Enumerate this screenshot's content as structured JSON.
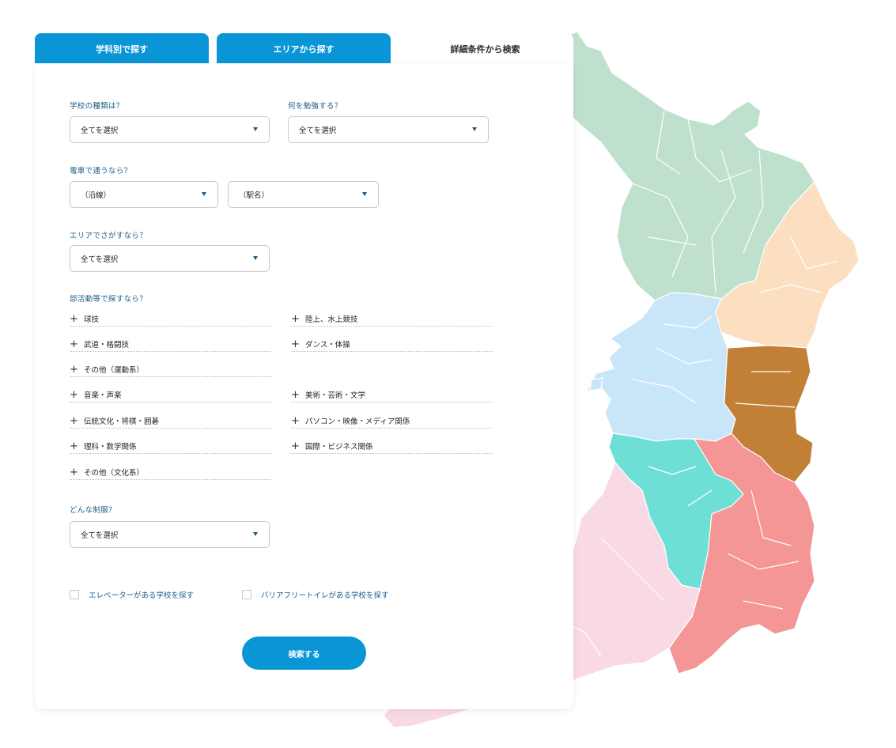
{
  "tabs": [
    {
      "label": "学科別で探す"
    },
    {
      "label": "エリアから探す"
    },
    {
      "label": "詳細条件から検索"
    }
  ],
  "school_type": {
    "label": "学校の種類は？",
    "value": "全てを選択"
  },
  "study": {
    "label": "何を勉強する？",
    "value": "全てを選択"
  },
  "train": {
    "label": "電車で通うなら？",
    "line_value": "（沿線）",
    "station_value": "（駅名）"
  },
  "area": {
    "label": "エリアでさがすなら？",
    "value": "全てを選択"
  },
  "clubs": {
    "label": "部活動等で探すなら？",
    "items": [
      "球技",
      "陸上、水上競技",
      "武道・格闘技",
      "ダンス・体操",
      "その他（運動系）",
      "音楽・声楽",
      "美術・芸術・文学",
      "伝統文化・将棋・囲碁",
      "パソコン・映像・メディア関係",
      "理科・数学関係",
      "国際・ビジネス関係",
      "その他（文化系）"
    ]
  },
  "uniform": {
    "label": "どんな制服？",
    "value": "全てを選択"
  },
  "checkboxes": {
    "elevator": "エレベーターがある学校を探す",
    "barrier_free": "バリアフリートイレがある学校を探す"
  },
  "submit_label": "検索する",
  "colors": {
    "accent": "#0a96d6",
    "label_text": "#1d5c88",
    "region_north": "#bfe0cd",
    "region_east_north": "#fbdfc0",
    "region_central": "#c9e6f8",
    "region_east_central": "#c27f36",
    "region_south_central": "#6edfd4",
    "region_south_east": "#f49696",
    "region_south": "#f8d9e5"
  }
}
